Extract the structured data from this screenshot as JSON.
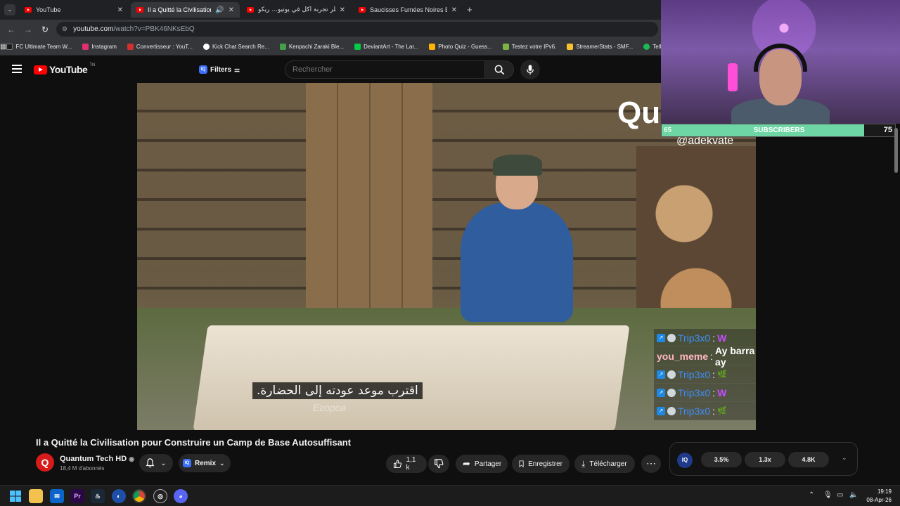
{
  "tabs": [
    {
      "title": "YouTube",
      "active": false
    },
    {
      "title": "Il a Quitté la Civilisation pour Construire un Camp de Base Autosuffisant",
      "active": true
    },
    {
      "title": "أخطر تجربة أكل في يوتيو... ريكو...",
      "active": false
    },
    {
      "title": "Saucisses Fumées Noires Bushc...",
      "active": false
    }
  ],
  "address": {
    "url_host": "youtube.com",
    "url_path": "/watch?v=PBK46NKsEbQ"
  },
  "bookmarks": [
    {
      "label": "FC Ultimate Team W...",
      "color": "#1a1a1a"
    },
    {
      "label": "Instagram",
      "color": "#e1306c"
    },
    {
      "label": "Convertisseur : YouT...",
      "color": "#d32f2f"
    },
    {
      "label": "Kick Chat Search Re...",
      "color": "#ffffff"
    },
    {
      "label": "Kenpachi Zaraki Ble...",
      "color": "#43a047"
    },
    {
      "label": "DeviantArt - The Lar...",
      "color": "#05cc47"
    },
    {
      "label": "Photo Quiz - Guess...",
      "color": "#ffb300"
    },
    {
      "label": "Testez votre IPv6.",
      "color": "#7cb342"
    },
    {
      "label": "StreamerStats - SMF...",
      "color": "#fbc02d"
    },
    {
      "label": "Tell It",
      "color": "#1db954"
    }
  ],
  "youtube": {
    "logo": "YouTube",
    "logo_sup": "TN",
    "filters_label": "Filters",
    "filters_badge": "IQ",
    "search_placeholder": "Rechercher"
  },
  "video": {
    "watermark": "Qu",
    "handle": "@adekvate",
    "subtitle": "اقترب موعد عودته إلى الحضارة.",
    "signature": "Егоров"
  },
  "overlay": {
    "subscribers": {
      "current": "65",
      "label": "SUBSCRIBERS",
      "goal": "75",
      "progress": 0.867
    },
    "chat": [
      {
        "user": "Trip3x0",
        "message": "",
        "emote": "W",
        "emote_color": "#c44cff"
      },
      {
        "user": "you_meme",
        "message": "Ay barra ay",
        "emote": "",
        "emote_color": ""
      },
      {
        "user": "Trip3x0",
        "message": "",
        "emote": "🌿",
        "emote_color": "#4caf50"
      },
      {
        "user": "Trip3x0",
        "message": "",
        "emote": "W",
        "emote_color": "#c44cff"
      },
      {
        "user": "Trip3x0",
        "message": "",
        "emote": "🌿",
        "emote_color": "#4caf50"
      }
    ]
  },
  "details": {
    "title": "Il a Quitté la Civilisation pour Construire un Camp de Base Autosuffisant",
    "channel": "Quantum Tech HD",
    "subscribers": "18,4 M d'abonnés",
    "remix_label": "Remix",
    "likes": "1,1 k",
    "share_label": "Partager",
    "save_label": "Enregistrer",
    "download_label": "Télécharger"
  },
  "iq_panel": {
    "badge": "IQ",
    "stats": [
      "3.5%",
      "1.3x",
      "4.8K"
    ]
  },
  "taskbar": {
    "time": "19:19",
    "date": "08-Apr-26"
  }
}
